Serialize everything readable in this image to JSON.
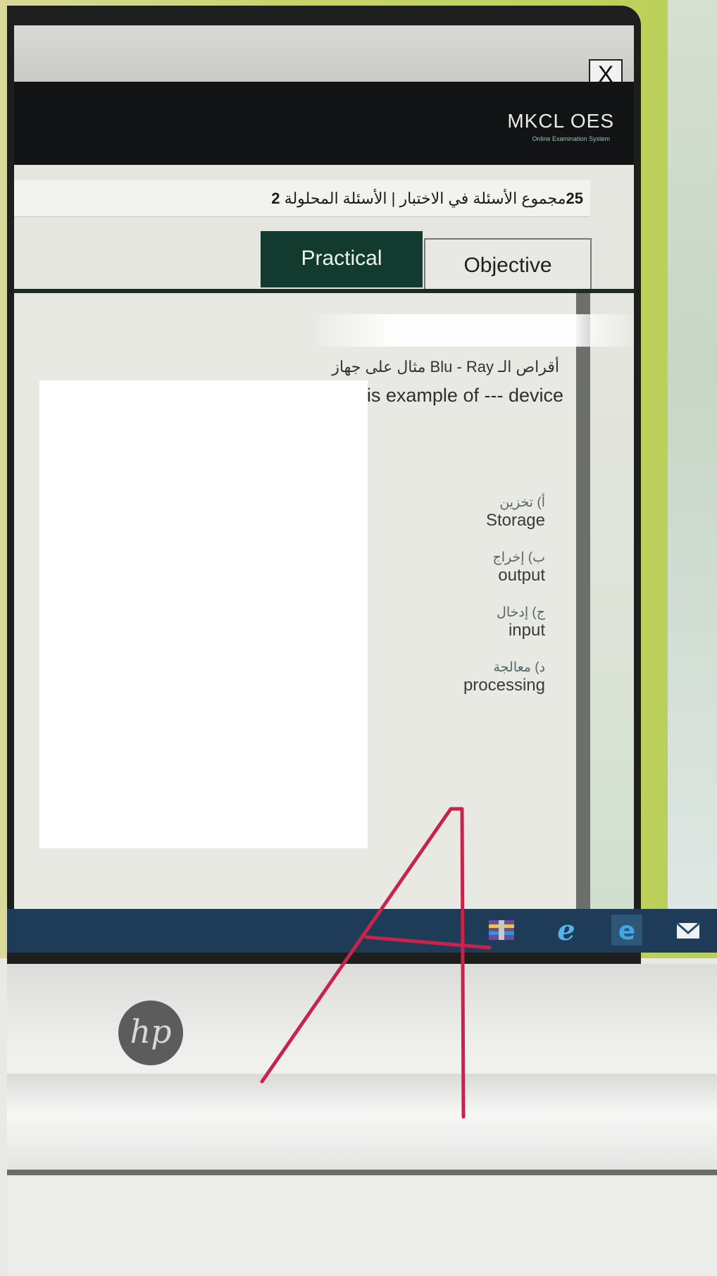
{
  "window": {
    "close_label": "X",
    "brand_name": "MKCL OES",
    "brand_tagline": "Online Examination System"
  },
  "stats": {
    "total_count": "25",
    "total_label": "مجموع الأسئلة في الاختبار",
    "separator": "|",
    "solved_label": "الأسئلة المحلولة",
    "solved_count": "2"
  },
  "tabs": [
    {
      "label": "Practical",
      "active": true
    },
    {
      "label": "Objective",
      "active": false
    }
  ],
  "question": {
    "text_ar": "أقراص الـ Blu - Ray مثال على جهاز",
    "text_en": "Blu- Ray Disks is example of --- device",
    "options": [
      {
        "ar": "أ) تخزين",
        "en": "Storage"
      },
      {
        "ar": "ب) إخراج",
        "en": "output"
      },
      {
        "ar": "ج) إدخال",
        "en": "input"
      },
      {
        "ar": "د) معالجة",
        "en": "processing"
      }
    ]
  },
  "taskbar": {
    "icons": [
      "winrar-icon",
      "internet-explorer-icon",
      "edge-icon",
      "mail-icon"
    ],
    "color": "#1e3b58"
  },
  "device": {
    "logo_text": "hp"
  },
  "annotation": {
    "color": "#c8234a"
  }
}
